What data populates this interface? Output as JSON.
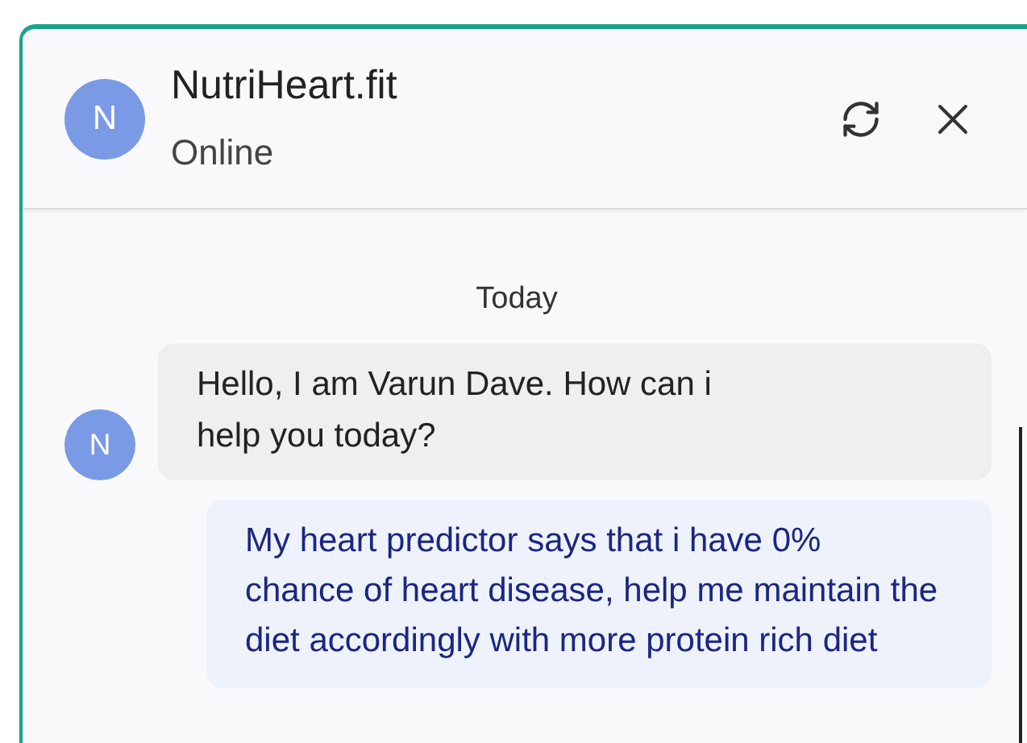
{
  "header": {
    "avatar": "N",
    "title": "NutriHeart.fit",
    "status": "Online"
  },
  "date_divider": "Today",
  "messages": [
    {
      "kind": "bot",
      "avatar": "N",
      "text": "Hello, I am Varun Dave. How can i help you today?"
    },
    {
      "kind": "user",
      "text": "My heart predictor says that i have 0% chance of heart disease, help me maintain the diet accordingly with more protein rich diet"
    }
  ]
}
